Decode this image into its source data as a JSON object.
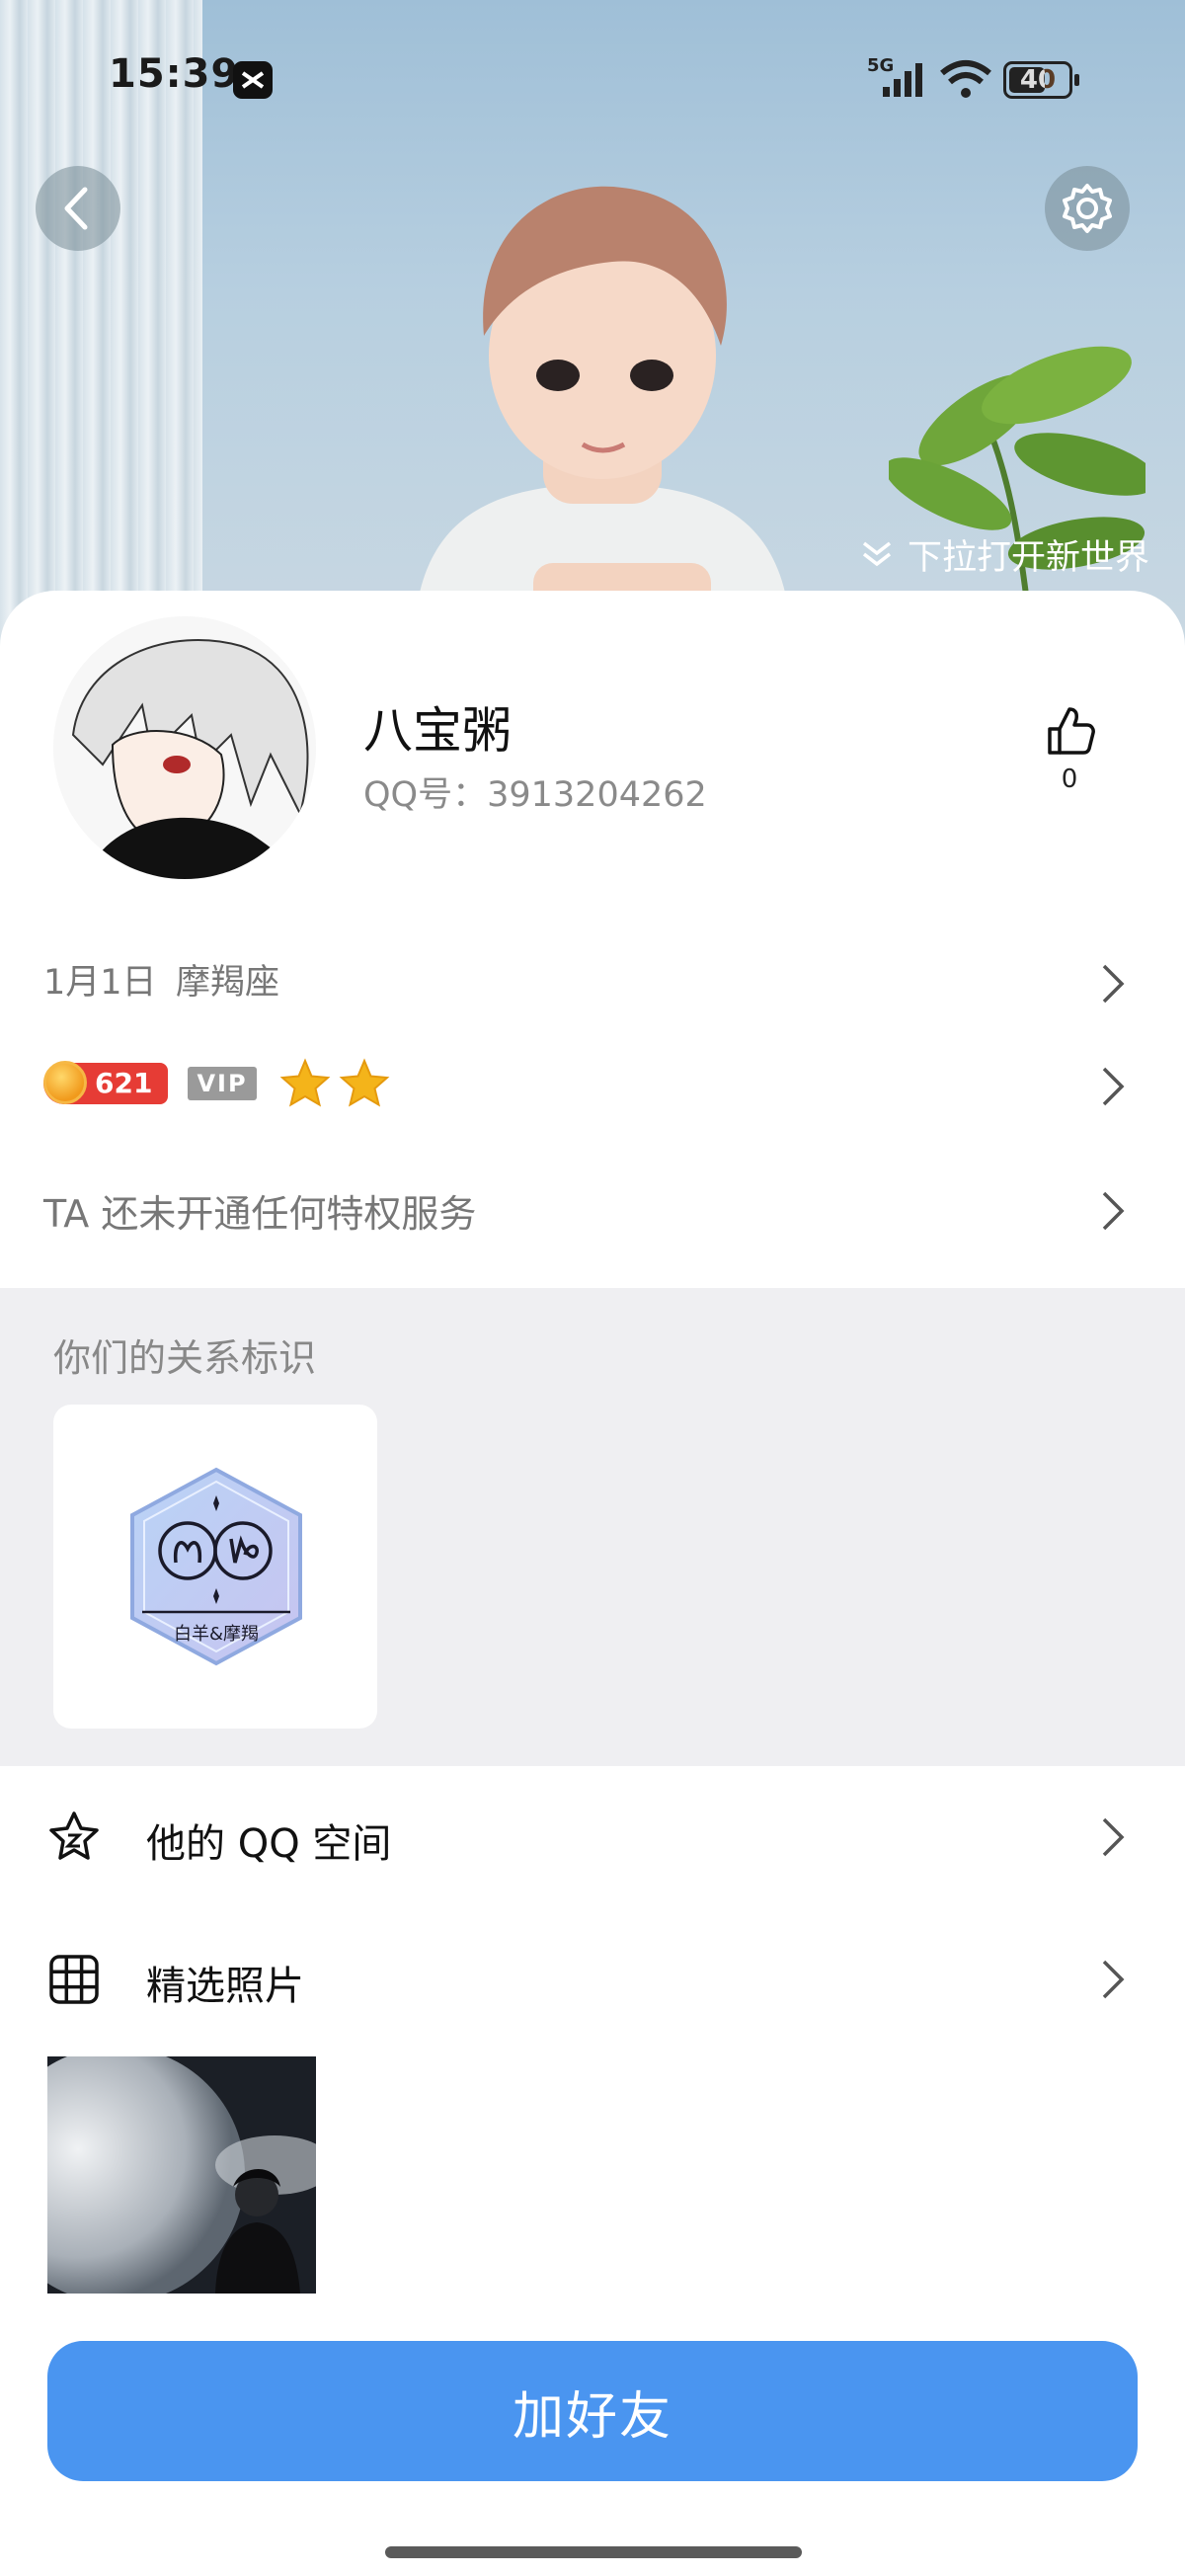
{
  "status_bar": {
    "time": "15:39",
    "network": "5G",
    "battery": "40"
  },
  "header": {
    "pull_hint": "下拉打开新世界"
  },
  "profile": {
    "nickname": "八宝粥",
    "qq_number": "QQ号：3913204262",
    "like_count": "0",
    "birthday": "1月1日",
    "zodiac": "摩羯座",
    "level": "621",
    "vip_label": "VIP",
    "privilege_text": "TA 还未开通任何特权服务"
  },
  "relationship": {
    "title": "你们的关系标识",
    "badge_text": "白羊&摩羯"
  },
  "list": {
    "qzone_label": "他的 QQ 空间",
    "photos_label": "精选照片"
  },
  "actions": {
    "add_friend": "加好友"
  },
  "colors": {
    "primary": "#4a95f0",
    "level_badge": "#e63c35",
    "star": "#f4b41a"
  }
}
